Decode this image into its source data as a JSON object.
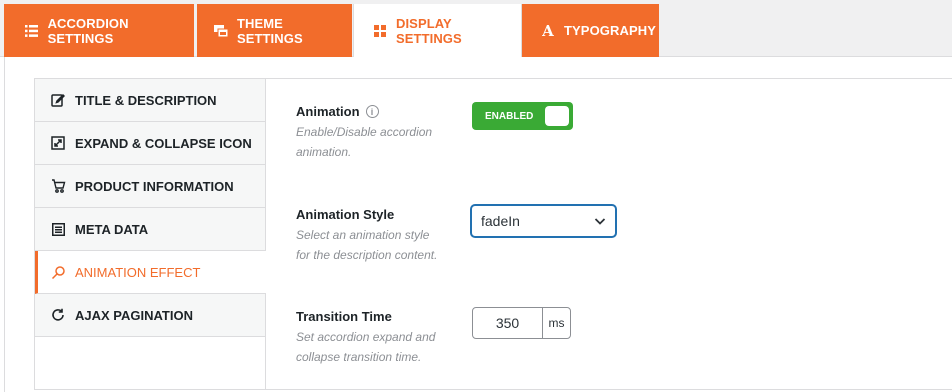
{
  "tabs": [
    {
      "label": "ACCORDION SETTINGS",
      "icon": "list-icon"
    },
    {
      "label": "THEME SETTINGS",
      "icon": "theme-icon"
    },
    {
      "label": "DISPLAY SETTINGS",
      "icon": "grid-icon",
      "active": true
    },
    {
      "label": "TYPOGRAPHY",
      "icon": "typography-icon"
    }
  ],
  "sidebar": {
    "items": [
      {
        "label": "TITLE & DESCRIPTION",
        "icon": "edit-icon"
      },
      {
        "label": "EXPAND & COLLAPSE ICON",
        "icon": "expand-collapse-icon"
      },
      {
        "label": "PRODUCT INFORMATION",
        "icon": "cart-icon"
      },
      {
        "label": "META DATA",
        "icon": "meta-data-icon"
      },
      {
        "label": "ANIMATION EFFECT",
        "icon": "magic-wand-icon",
        "active": true
      },
      {
        "label": "AJAX PAGINATION",
        "icon": "refresh-icon"
      }
    ]
  },
  "fields": {
    "animation": {
      "label": "Animation",
      "help_icon": "i",
      "desc_line1": "Enable/Disable accordion",
      "desc_line2": "animation.",
      "toggle_label": "ENABLED"
    },
    "animation_style": {
      "label": "Animation Style",
      "desc_line1": "Select an animation style",
      "desc_line2": "for the description content.",
      "value": "fadeIn"
    },
    "transition_time": {
      "label": "Transition Time",
      "desc_line1": "Set accordion expand and",
      "desc_line2": "collapse transition time.",
      "value": "350",
      "unit": "ms"
    }
  },
  "colors": {
    "accent": "#f26c2b",
    "toggle_on": "#3aaa35",
    "focus": "#2271b1"
  }
}
